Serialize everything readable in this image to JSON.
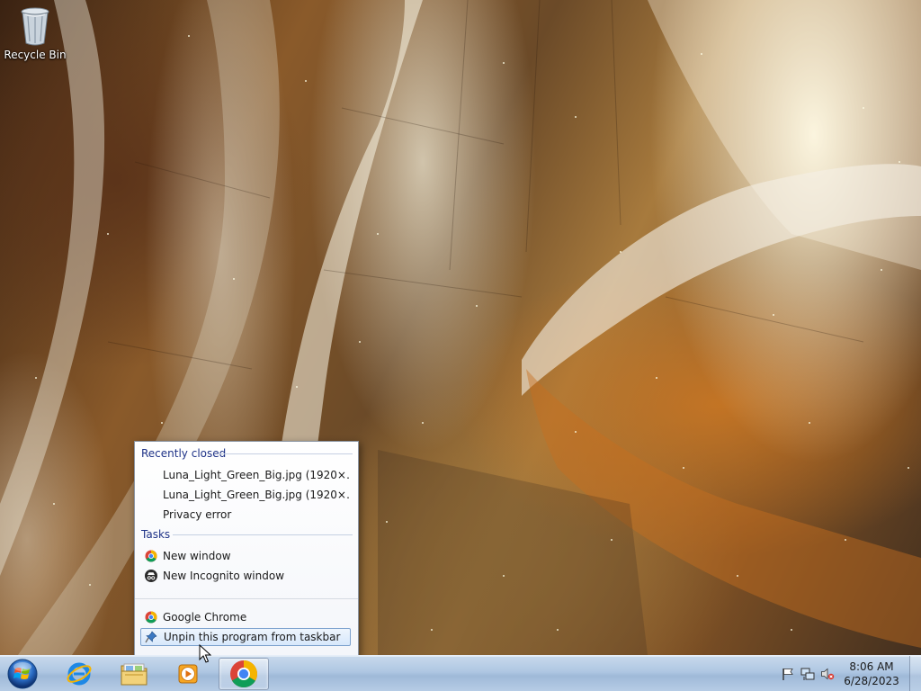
{
  "desktop": {
    "icons": [
      {
        "label": "Recycle Bin",
        "icon": "recycle-bin-icon"
      }
    ]
  },
  "jump_list": {
    "recently_closed": {
      "header": "Recently closed",
      "items": [
        {
          "label": "Luna_Light_Green_Big.jpg (1920×…"
        },
        {
          "label": "Luna_Light_Green_Big.jpg (1920×…"
        },
        {
          "label": "Privacy error"
        }
      ]
    },
    "tasks": {
      "header": "Tasks",
      "items": [
        {
          "label": "New window",
          "icon": "chrome-icon"
        },
        {
          "label": "New Incognito window",
          "icon": "incognito-icon"
        }
      ]
    },
    "app_items": [
      {
        "label": "Google Chrome",
        "icon": "chrome-icon"
      },
      {
        "label": "Unpin this program from taskbar",
        "icon": "unpin-icon",
        "highlighted": true
      }
    ]
  },
  "taskbar": {
    "start": {
      "icon": "windows-orb-icon"
    },
    "pinned": [
      {
        "name": "internet-explorer",
        "icon": "internet-explorer-icon"
      },
      {
        "name": "windows-explorer",
        "icon": "folder-icon"
      },
      {
        "name": "windows-media-player",
        "icon": "media-player-icon"
      },
      {
        "name": "google-chrome",
        "icon": "chrome-icon",
        "active": true
      }
    ],
    "tray": {
      "icons": [
        "action-center-flag-icon",
        "network-icon",
        "volume-muted-icon"
      ],
      "time": "8:06 AM",
      "date": "6/28/2023"
    }
  },
  "colors": {
    "jump_list_header": "#1e3287",
    "taskbar_top": "#c8d9ec",
    "taskbar_bottom": "#9fb9d8",
    "hover_border": "#7da2ce"
  }
}
